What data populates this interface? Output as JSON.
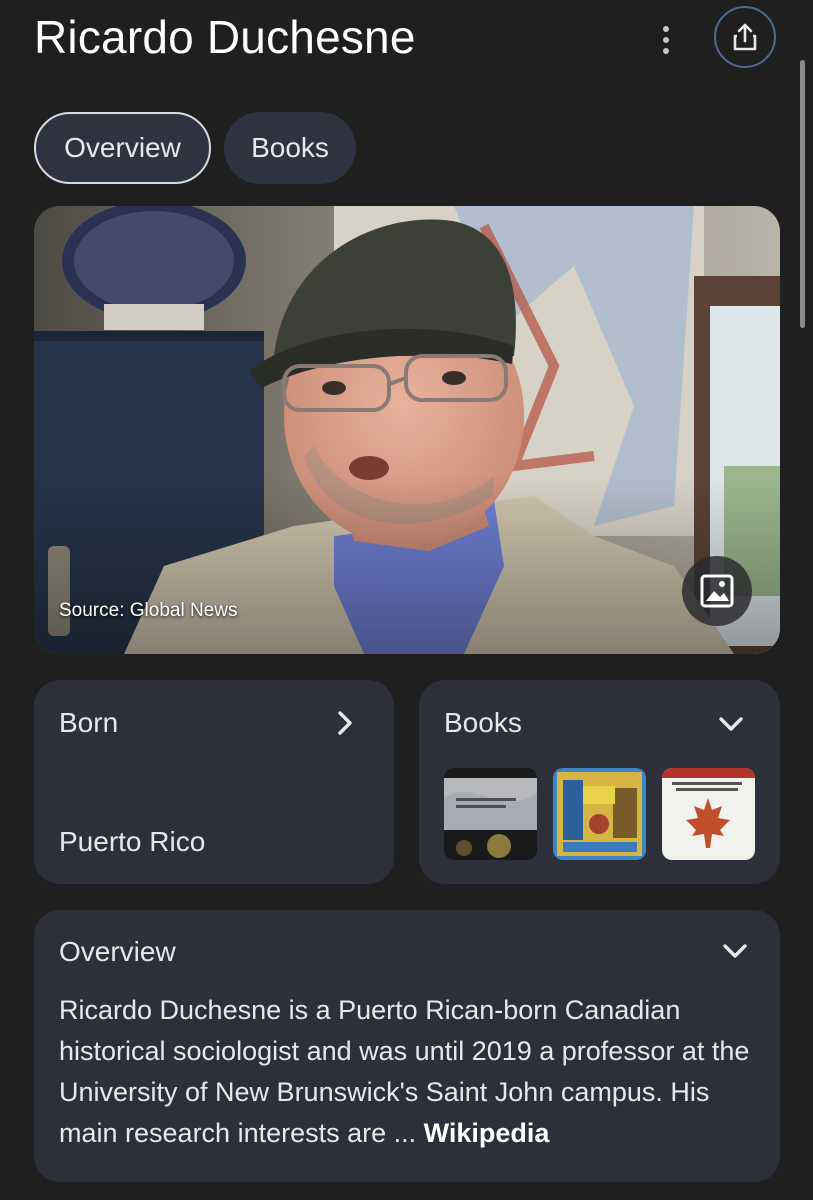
{
  "header": {
    "title": "Ricardo Duchesne"
  },
  "tabs": [
    {
      "label": "Overview",
      "active": true
    },
    {
      "label": "Books",
      "active": false
    }
  ],
  "photo": {
    "source": "Source: Global News"
  },
  "born": {
    "label": "Born",
    "value": "Puerto Rico"
  },
  "books": {
    "label": "Books",
    "covers": [
      {
        "icon": "book-cover-uniqueness-western-civilization"
      },
      {
        "icon": "book-cover-ruin"
      },
      {
        "icon": "book-cover-maple-leaf"
      }
    ]
  },
  "overview": {
    "label": "Overview",
    "text": "Ricardo Duchesne is a Puerto Rican-born Canadian historical sociologist and was until 2019 a professor at the University of New Brunswick's Saint John campus. His main research interests are ",
    "ellipsis": "... ",
    "source_link": "Wikipedia"
  },
  "colors": {
    "background": "#1f1f1f",
    "card": "#2d2f3a",
    "accent_border": "#4f6a8f"
  }
}
